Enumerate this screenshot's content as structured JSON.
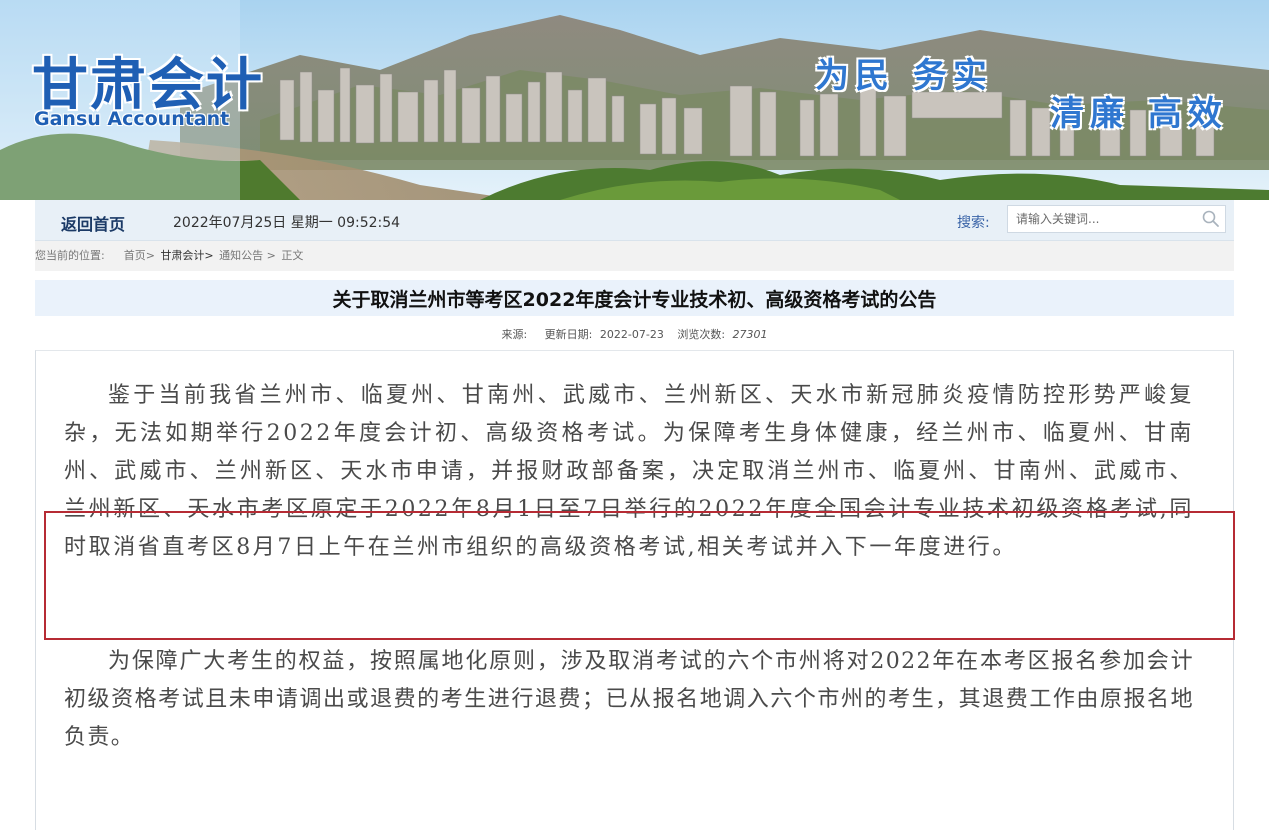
{
  "header": {
    "logo_cn": "甘肃会计",
    "logo_en": "Gansu Accountant",
    "slogan_line1": "为民 务实",
    "slogan_line2": "清廉 高效"
  },
  "navbar": {
    "home_label": "返回首页",
    "datetime": "2022年07月25日 星期一 09:52:54",
    "search_label": "搜索:",
    "search_placeholder": "请输入关键词...",
    "search_icon": "search-icon"
  },
  "breadcrumb": {
    "prefix": "您当前的位置:",
    "items": [
      "首页>",
      "甘肃会计>",
      "通知公告 >",
      "正文"
    ]
  },
  "article": {
    "title": "关于取消兰州市等考区2022年度会计专业技术初、高级资格考试的公告",
    "meta": {
      "source_label": "来源:",
      "update_label": "更新日期:",
      "update_date": "2022-07-23",
      "views_label": "浏览次数:",
      "views_count": "27301"
    },
    "paragraphs": [
      "鉴于当前我省兰州市、临夏州、甘南州、武威市、兰州新区、天水市新冠肺炎疫情防控形势严峻复杂，无法如期举行2022年度会计初、高级资格考试。为保障考生身体健康，经兰州市、临夏州、甘南州、武威市、兰州新区、天水市申请，并报财政部备案，决定取消兰州市、临夏州、甘南州、武威市、兰州新区、天水市考区原定于2022年8月1日至7日举行的2022年度全国会计专业技术初级资格考试,同时取消省直考区8月7日上午在兰州市组织的高级资格考试,相关考试并入下一年度进行。",
      "为保障广大考生的权益，按照属地化原则，涉及取消考试的六个市州将对2022年在本考区报名参加会计初级资格考试且未申请调出或退费的考生进行退费；已从报名地调入六个市州的考生，其退费工作由原报名地负责。"
    ]
  },
  "colors": {
    "brand_blue": "#1f5fb4",
    "highlight_red": "#b62b34",
    "navbar_bg": "#e8f0f7"
  }
}
